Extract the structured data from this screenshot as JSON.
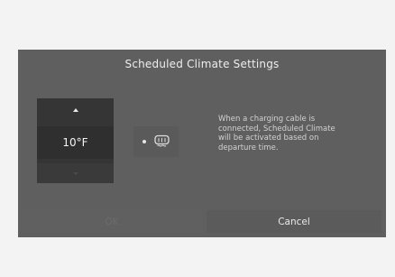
{
  "dialog": {
    "title": "Scheduled Climate Settings",
    "temperature": {
      "value": "10°F",
      "up_icon": "triangle-up-icon",
      "down_icon": "triangle-down-icon"
    },
    "defrost": {
      "icon": "rear-defrost-icon",
      "indicator_on": true
    },
    "info_text": "When a charging cable is\nconnected, Scheduled Climate\nwill be activated based on\ndeparture time.",
    "buttons": {
      "ok_label": "OK",
      "cancel_label": "Cancel"
    }
  },
  "colors": {
    "page_background": "#f3f3f3",
    "dialog_background": "#5f5f5f",
    "temp_panel": "#353535",
    "text_primary": "#eeeeee",
    "text_disabled": "#6b6b6b"
  }
}
